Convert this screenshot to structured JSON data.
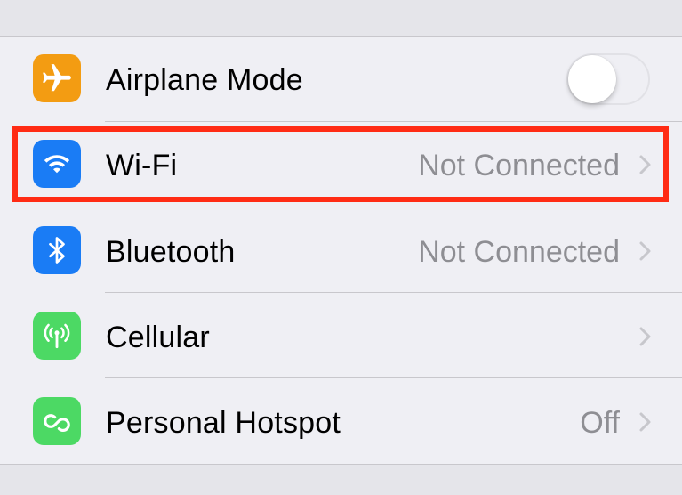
{
  "settings": {
    "rows": [
      {
        "label": "Airplane Mode",
        "icon": "airplane-icon",
        "icon_color": "#f39c12",
        "control": "toggle",
        "toggle_on": false
      },
      {
        "label": "Wi-Fi",
        "icon": "wifi-icon",
        "icon_color": "#1a7cf5",
        "value": "Not Connected",
        "highlighted": true
      },
      {
        "label": "Bluetooth",
        "icon": "bluetooth-icon",
        "icon_color": "#1a7cf5",
        "value": "Not Connected"
      },
      {
        "label": "Cellular",
        "icon": "cellular-antenna-icon",
        "icon_color": "#4cd964",
        "value": ""
      },
      {
        "label": "Personal Hotspot",
        "icon": "hotspot-icon",
        "icon_color": "#4cd964",
        "value": "Off"
      }
    ],
    "highlight_color": "#ff2b14"
  }
}
